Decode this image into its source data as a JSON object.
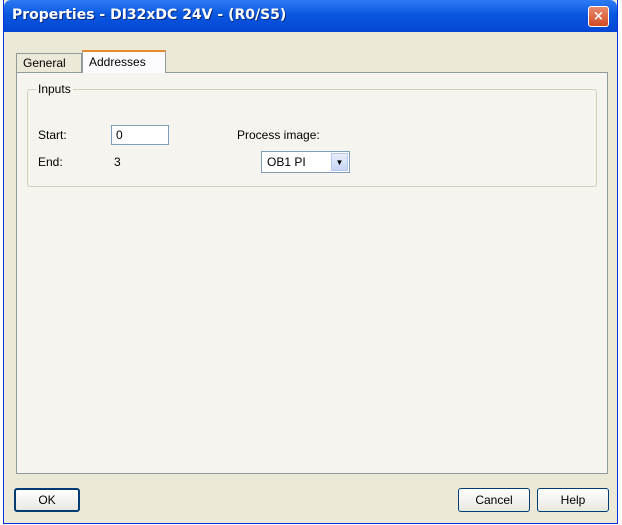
{
  "window": {
    "title": "Properties - DI32xDC 24V - (R0/S5)",
    "close_glyph": "×"
  },
  "tabs": [
    {
      "label": "General",
      "active": false
    },
    {
      "label": "Addresses",
      "active": true
    }
  ],
  "inputs_group": {
    "legend": "Inputs",
    "start_label": "Start:",
    "start_value": "0",
    "end_label": "End:",
    "end_value": "3",
    "process_image_label": "Process image:",
    "process_image_value": "OB1 PI"
  },
  "buttons": {
    "ok": "OK",
    "cancel": "Cancel",
    "help": "Help"
  },
  "colors": {
    "titlebar": "#0a58e0",
    "dialog_bg": "#ece9d8",
    "active_tab_accent": "#e68b2c"
  }
}
